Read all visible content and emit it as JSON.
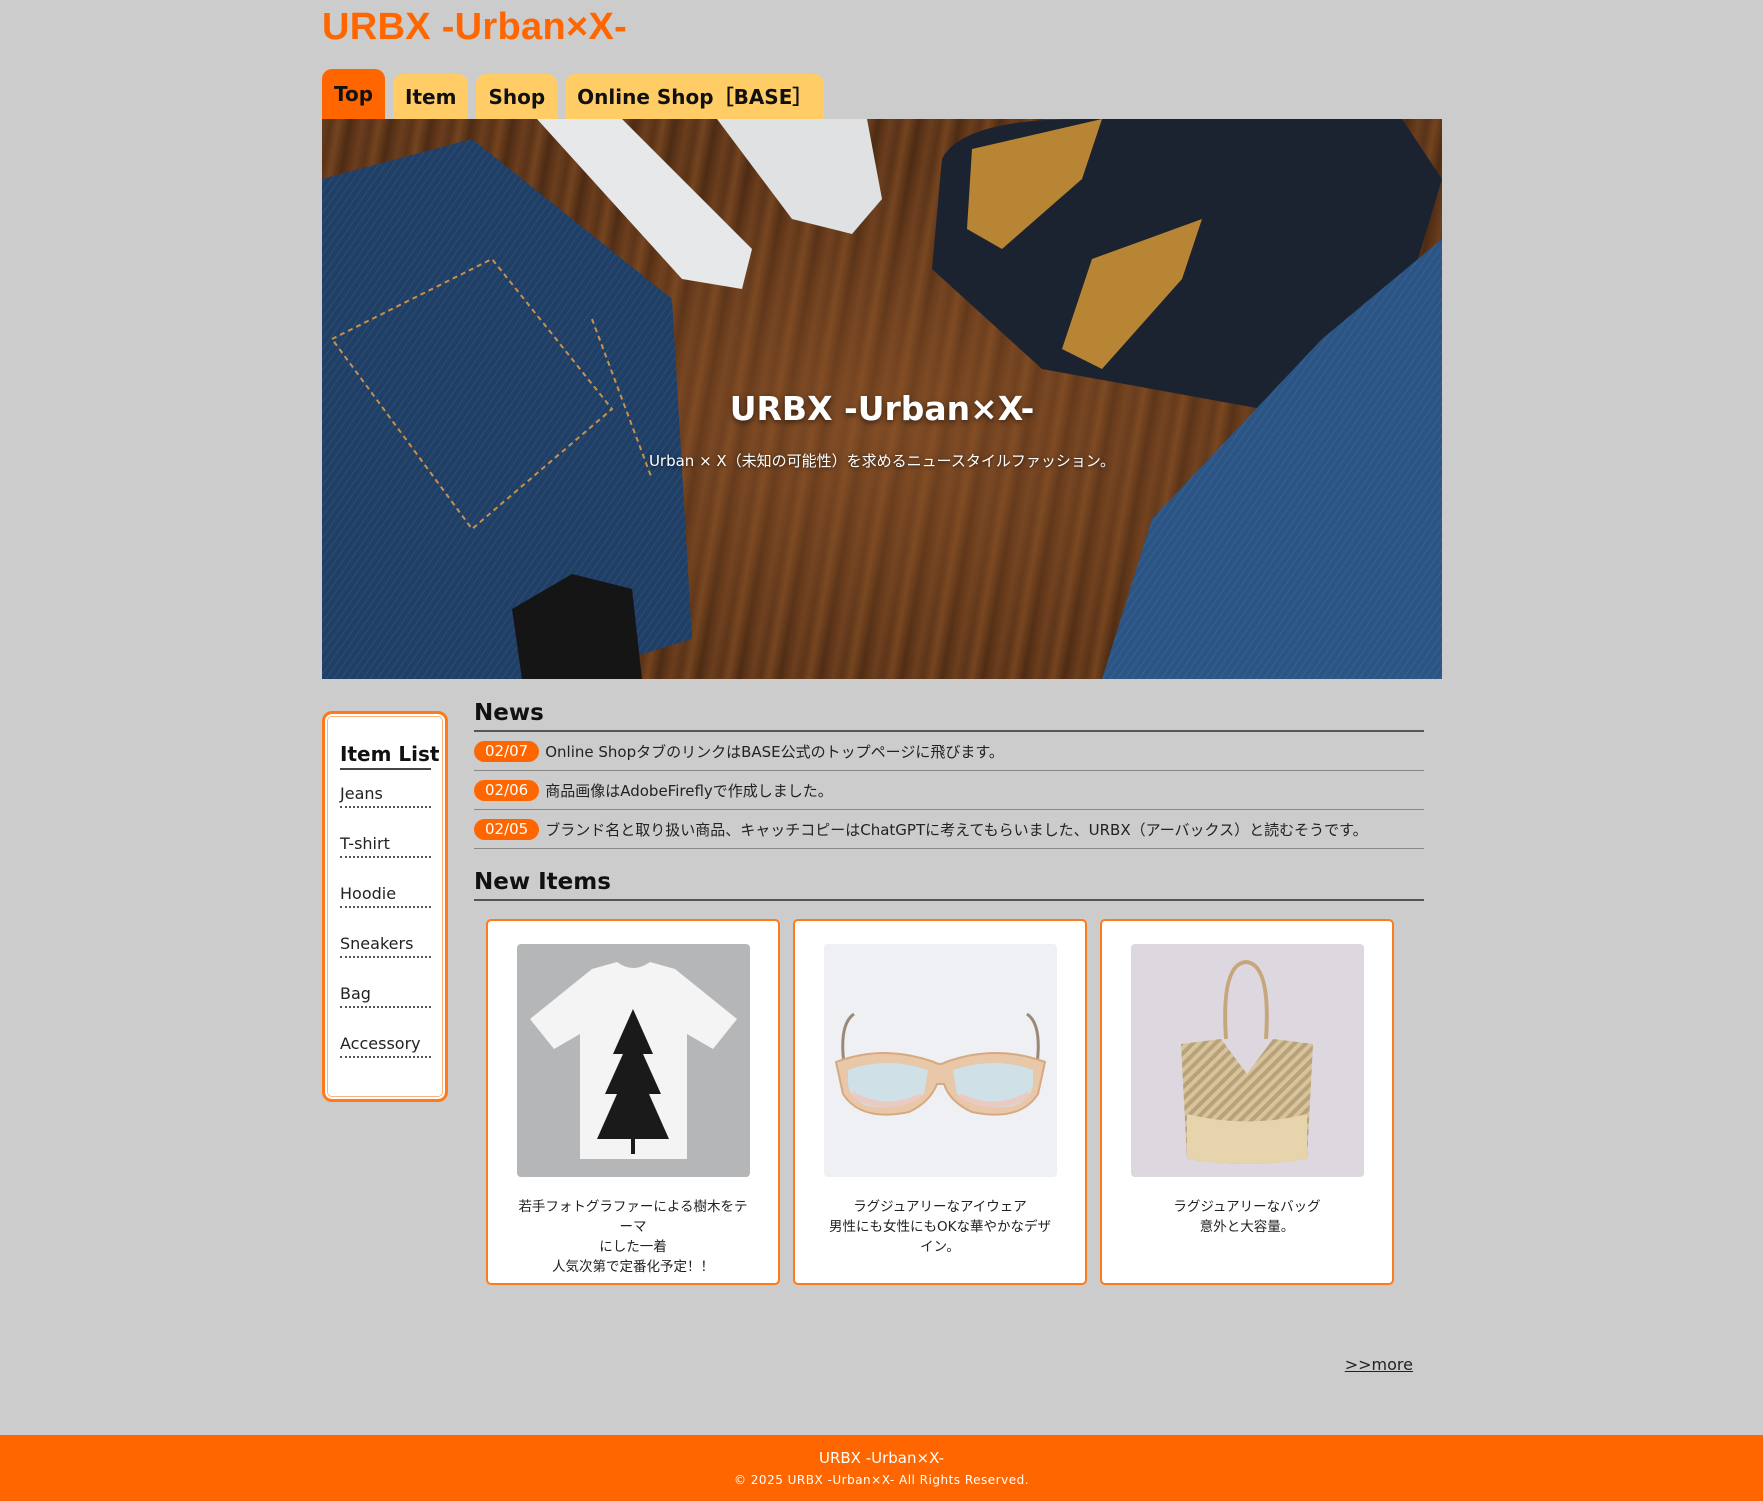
{
  "header": {
    "site_title": "URBX -Urban×X-"
  },
  "nav": {
    "tabs": [
      {
        "label": "Top",
        "active": true
      },
      {
        "label": "Item",
        "active": false
      },
      {
        "label": "Shop",
        "active": false
      },
      {
        "label": "Online Shop［BASE］",
        "active": false
      }
    ]
  },
  "hero": {
    "title": "URBX -Urban×X-",
    "subtitle": "Urban × X（未知の可能性）を求めるニュースタイルファッション。"
  },
  "sidebar": {
    "heading": "Item List",
    "items": [
      "Jeans",
      "T-shirt",
      "Hoodie",
      "Sneakers",
      "Bag",
      "Accessory"
    ]
  },
  "news": {
    "heading": "News",
    "entries": [
      {
        "date": "02/07",
        "text": "Online ShopタブのリンクはBASE公式のトップページに飛びます。"
      },
      {
        "date": "02/06",
        "text": "商品画像はAdobeFireflyで作成しました。"
      },
      {
        "date": "02/05",
        "text": "ブランド名と取り扱い商品、キャッチコピーはChatGPTに考えてもらいました、URBX（アーバックス）と読むそうです。"
      }
    ]
  },
  "new_items": {
    "heading": "New Items",
    "cards": [
      {
        "image": "tshirt-tree-print",
        "lines": [
          "若手フォトグラファーによる樹木をテーマ",
          "にした一着",
          "人気次第で定番化予定！！"
        ]
      },
      {
        "image": "luxury-sunglasses",
        "lines": [
          "ラグジュアリーなアイウェア",
          "男性にも女性にもOKな華やかなデザイン。"
        ]
      },
      {
        "image": "luxury-tote-bag",
        "lines": [
          "ラグジュアリーなバッグ",
          "意外と大容量。"
        ]
      }
    ],
    "more_link": ">>more"
  },
  "footer": {
    "title": "URBX -Urban×X-",
    "copyright": "© 2025 URBX -Urban×X- All Rights Reserved."
  },
  "colors": {
    "accent": "#ff6600",
    "tab_inactive": "#ffcc66",
    "background": "#cccccc"
  }
}
